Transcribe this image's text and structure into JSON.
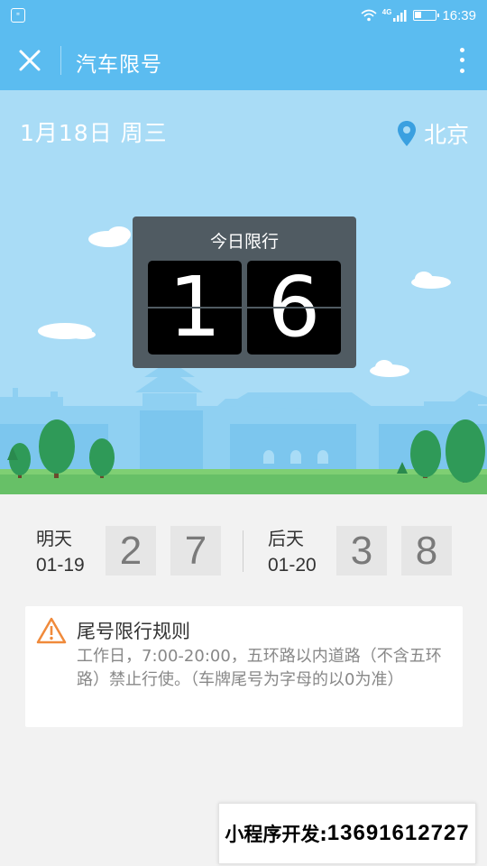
{
  "status_bar": {
    "app_icon": "message-app-icon",
    "network": "4G",
    "time": "16:39"
  },
  "title_bar": {
    "title": "汽车限号",
    "close_icon": "close-icon",
    "more_icon": "more-vertical-icon"
  },
  "hero": {
    "date": "1月18日 周三",
    "city": "北京",
    "board_title": "今日限行",
    "digits": [
      "1",
      "6"
    ]
  },
  "upcoming": [
    {
      "label": "明天",
      "date": "01-19",
      "digits": [
        "2",
        "7"
      ]
    },
    {
      "label": "后天",
      "date": "01-20",
      "digits": [
        "3",
        "8"
      ]
    }
  ],
  "rules": {
    "title": "尾号限行规则",
    "text": "工作日，7:00-20:00，五环路以内道路（不含五环路）禁止行使。（车牌尾号为字母的以0为准）"
  },
  "badge": {
    "label": "小程序开发:",
    "phone": "13691612727"
  },
  "colors": {
    "header": "#5bbcf0",
    "sky": "#a9dcf6",
    "board": "#505b62",
    "warning": "#f08a3b",
    "pin": "#3aa0e0"
  }
}
